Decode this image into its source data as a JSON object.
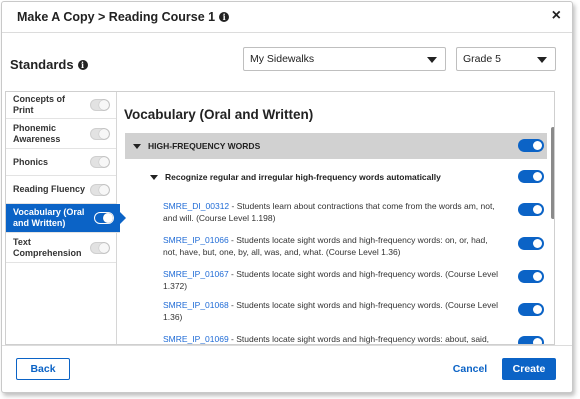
{
  "dialog": {
    "title": "Make A Copy > Reading Course 1",
    "close_label": "×"
  },
  "standards": {
    "label": "Standards",
    "info_label": "i"
  },
  "filters": {
    "program": "My Sidewalks",
    "grade": "Grade 5"
  },
  "sidebar": {
    "items": [
      {
        "label": "Concepts of Print",
        "enabled": false,
        "active": false
      },
      {
        "label": "Phonemic Awareness",
        "enabled": false,
        "active": false
      },
      {
        "label": "Phonics",
        "enabled": false,
        "active": false
      },
      {
        "label": "Reading Fluency",
        "enabled": false,
        "active": false
      },
      {
        "label": "Vocabulary (Oral and Written)",
        "enabled": true,
        "active": true
      },
      {
        "label": "Text Comprehension",
        "enabled": false,
        "active": false
      }
    ]
  },
  "content": {
    "heading": "Vocabulary (Oral and Written)",
    "group_label": "HIGH-FREQUENCY WORDS",
    "subgroup_label": "Recognize regular and irregular high-frequency words automatically",
    "standards": [
      {
        "code": "SMRE_DI_00312",
        "text": " - Students learn about contractions that come from the words am, not, and will. (Course Level 1.198)"
      },
      {
        "code": "SMRE_IP_01066",
        "text": " - Students locate sight words and high-frequency words: on, or, had, not, have, but, one, by, all, was, and, what. (Course Level 1.36)"
      },
      {
        "code": "SMRE_IP_01067",
        "text": " - Students locate sight words and high-frequency words. (Course Level 1.372)"
      },
      {
        "code": "SMRE_IP_01068",
        "text": " - Students locate sight words and high-frequency words. (Course Level 1.36)"
      },
      {
        "code": "SMRE_IP_01069",
        "text": " - Students locate sight words and high-frequency words: about, said, many,"
      }
    ]
  },
  "footer": {
    "back_label": "Back",
    "cancel_label": "Cancel",
    "create_label": "Create"
  },
  "colors": {
    "accent": "#0b63c6",
    "link": "#1f6bd6",
    "group_bar": "#d1d1d1"
  }
}
